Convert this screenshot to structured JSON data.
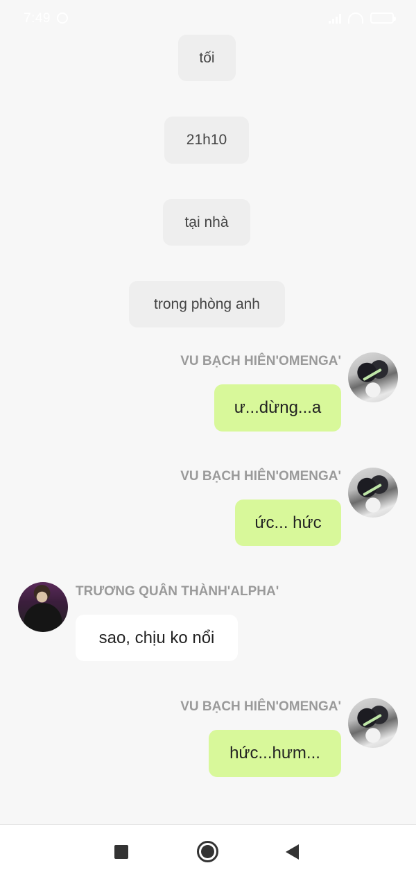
{
  "status_bar": {
    "time": "7:49"
  },
  "narration": [
    "tối",
    "21h10",
    "tại nhà",
    "trong phòng anh"
  ],
  "messages": [
    {
      "sender": "VU BẠCH HIÊN'OMENGA'",
      "text": "ư...dừng...a",
      "side": "right",
      "avatar": "avatar-vu"
    },
    {
      "sender": "VU BẠCH HIÊN'OMENGA'",
      "text": "ức... hức",
      "side": "right",
      "avatar": "avatar-vu"
    },
    {
      "sender": "TRƯƠNG QUÂN THÀNH'ALPHA'",
      "text": "sao, chịu ko nổi",
      "side": "left",
      "avatar": "avatar-truong"
    },
    {
      "sender": "VU BẠCH HIÊN'OMENGA'",
      "text": "hức...hưm...",
      "side": "right",
      "avatar": "avatar-vu"
    }
  ],
  "colors": {
    "background": "#f7f7f7",
    "narration_bubble": "#eeeeee",
    "own_bubble": "#d8f89a",
    "other_bubble": "#ffffff",
    "sender_name": "#9a9a9a"
  },
  "nav_bar": {
    "icons": [
      "recent-apps-icon",
      "home-icon",
      "back-icon"
    ]
  }
}
